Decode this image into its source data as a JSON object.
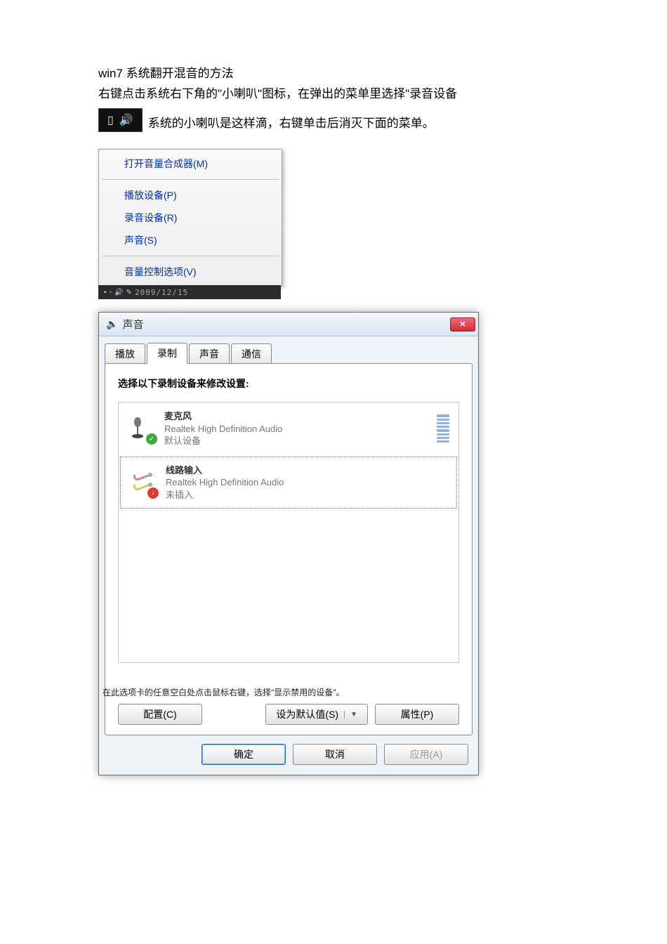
{
  "intro": {
    "line1": "win7 系统翻开混音的方法",
    "line2": "右键点击系统右下角的\"小喇叭\"图标，在弹出的菜单里选择\"录音设备",
    "tray_caption": "系统的小喇叭是这样滴，右键单击后消灭下面的菜单。"
  },
  "context_menu": {
    "items_group1": [
      "打开音量合成器(M)"
    ],
    "items_group2": [
      "播放设备(P)",
      "录音设备(R)",
      "声音(S)"
    ],
    "items_group3": [
      "音量控制选项(V)"
    ]
  },
  "status_sliver": {
    "date": "2009/12/15"
  },
  "dialog": {
    "title": "声音",
    "tabs": [
      "播放",
      "录制",
      "声音",
      "通信"
    ],
    "active_tab_index": 1,
    "panel_caption": "选择以下录制设备来修改设置:",
    "devices": [
      {
        "name": "麦克风",
        "driver": "Realtek High Definition Audio",
        "status": "默认设备",
        "badge": "ok",
        "show_meter": true
      },
      {
        "name": "线路输入",
        "driver": "Realtek High Definition Audio",
        "status": "未插入",
        "badge": "down",
        "show_meter": false,
        "selected": true
      }
    ],
    "hint": "在此选项卡的任意空白处点击鼠标右键，选择\"显示禁用的设备\"。",
    "buttons_inner": {
      "configure": "配置(C)",
      "set_default": "设为默认值(S)",
      "properties": "属性(P)"
    },
    "buttons_footer": {
      "ok": "确定",
      "cancel": "取消",
      "apply": "应用(A)"
    }
  }
}
